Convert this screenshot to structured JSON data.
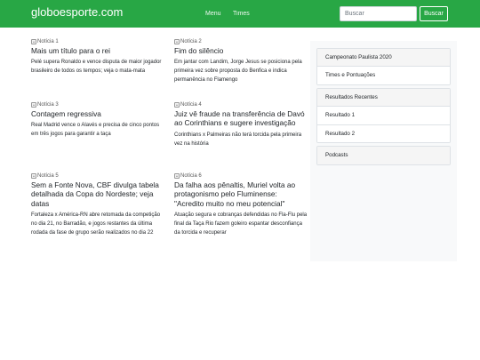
{
  "navbar": {
    "brand": "globoesporte.com",
    "links": [
      "Menu",
      "Times"
    ],
    "search": {
      "placeholder": "Buscar",
      "value": "",
      "button_label": "Buscar"
    }
  },
  "colors": {
    "accent": "#28a745",
    "sidebar_bg": "#f8f9fa",
    "card_border": "#dee2e6"
  },
  "news": [
    {
      "image_alt": "Notícia 1",
      "title": "Mais um título para o rei",
      "text": "Pelé supera Ronaldo e vence disputa de maior jogador brasileiro de todos os tempos; veja o mata-mata"
    },
    {
      "image_alt": "Notícia 2",
      "title": "Fim do silêncio",
      "text": "Em jantar com Landim, Jorge Jesus se posiciona pela primeira vez sobre proposta do Benfica e indica permanência no Flamengo"
    },
    {
      "image_alt": "Notícia 3",
      "title": "Contagem regressiva",
      "text": "Real Madrid vence o Alavés e precisa de cinco pontos em três jogos para garantir a taça"
    },
    {
      "image_alt": "Notícia 4",
      "title": "Juiz vê fraude na transferência de Davó ao Corinthians e sugere investigação",
      "text": "Corinthians x Palmeiras não terá torcida pela primeira vez na história"
    },
    {
      "image_alt": "Notícia 5",
      "title": "Sem a Fonte Nova, CBF divulga tabela detalhada da Copa do Nordeste; veja datas",
      "text": "Fortaleza x América-RN abre retomada da competição no dia 21, no Barradão, e jogos restantes da última rodada da fase de grupo serão realizados no dia 22"
    },
    {
      "image_alt": "Notícia 6",
      "title": "Da falha aos pênaltis, Muriel volta ao protagonismo pelo Fluminense: \"Acredito muito no meu potencial\"",
      "text": "Atuação segura e cobranças defendidas no Fla-Flu pela final da Taça Rio fazem goleiro espantar desconfiança da torcida e recuperar"
    }
  ],
  "sidebar": {
    "cards": [
      {
        "header": "Campeonato Paulista 2020",
        "items": [
          "Times e Pontuações"
        ]
      },
      {
        "header": "Resultados Recentes",
        "items": [
          "Resultado 1",
          "Resultado 2"
        ]
      },
      {
        "header": "Podcasts",
        "items": []
      }
    ]
  }
}
